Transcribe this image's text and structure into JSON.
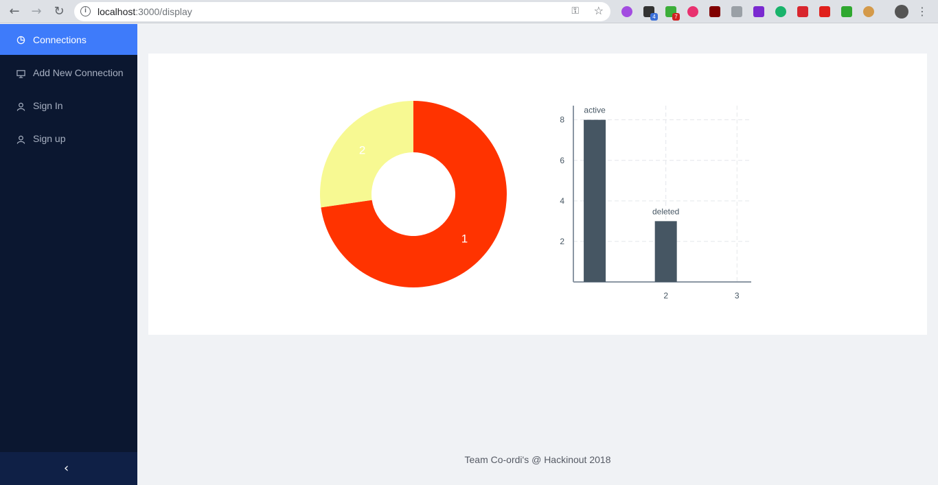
{
  "browser": {
    "url_host": "localhost",
    "url_rest": ":3000/display",
    "extension_badges": [
      "4",
      "7"
    ]
  },
  "sidebar": {
    "items": [
      {
        "label": "Connections",
        "icon": "pie-chart-icon",
        "active": true
      },
      {
        "label": "Add New Connection",
        "icon": "desktop-icon",
        "active": false
      },
      {
        "label": "Sign In",
        "icon": "user-icon",
        "active": false
      },
      {
        "label": "Sign up",
        "icon": "user-icon",
        "active": false
      }
    ],
    "collapse_icon": "chevron-left-icon"
  },
  "footer": {
    "text": "Team Co-ordi's @ Hackinout 2018"
  },
  "colors": {
    "pie_1": "#ff3300",
    "pie_2": "#f7f992",
    "bar": "#465663",
    "sidebar_bg": "#0b1730",
    "active_item": "#3e7bfa"
  },
  "chart_data": [
    {
      "type": "pie",
      "hole": true,
      "slices": [
        {
          "label": "1",
          "value": 8
        },
        {
          "label": "2",
          "value": 3
        }
      ]
    },
    {
      "type": "bar",
      "bars": [
        {
          "x": 1,
          "value": 8,
          "label": "active"
        },
        {
          "x": 2,
          "value": 3,
          "label": "deleted"
        }
      ],
      "x_ticks": [
        "2",
        "3"
      ],
      "y_ticks": [
        2,
        4,
        6,
        8
      ],
      "xlim": [
        0.7,
        3.2
      ],
      "ylim": [
        0,
        8.7
      ],
      "grid": true
    }
  ]
}
